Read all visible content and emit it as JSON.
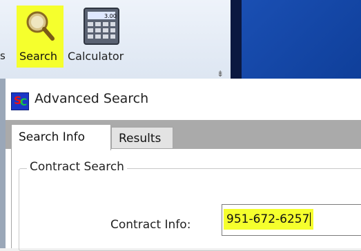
{
  "toolbar": {
    "cut_label": "s",
    "search_label": "Search",
    "calculator_label": "Calculator",
    "calculator_display": "3.00",
    "grip_glyph": "⇟"
  },
  "dialog": {
    "title": "Advanced Search",
    "tabs": [
      {
        "label": "Search Info",
        "selected": true
      },
      {
        "label": "Results",
        "selected": false
      }
    ],
    "group_title": "Contract Search",
    "contract_info_label": "Contract Info:",
    "contract_info_value": "951-672-6257"
  },
  "colors": {
    "highlight": "#f5ff2d",
    "app_icon_blue": "#1b37c7",
    "desktop_blue": "#1a4fb3"
  }
}
